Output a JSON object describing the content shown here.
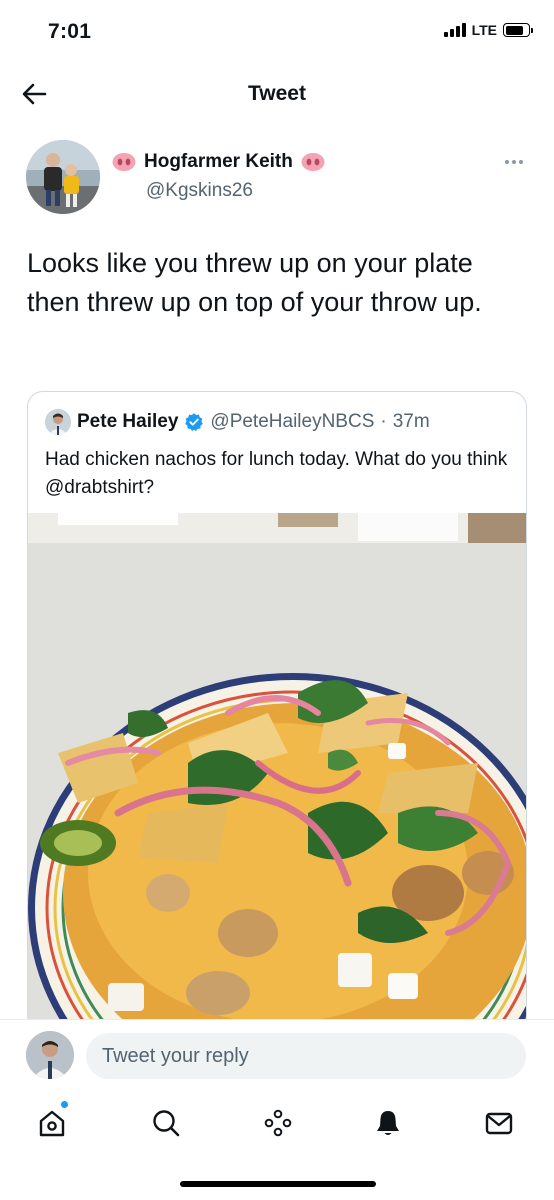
{
  "status_bar": {
    "time": "7:01",
    "network": "LTE",
    "battery_level": 0.8
  },
  "header": {
    "title": "Tweet",
    "back_icon": "arrow-left-icon"
  },
  "tweet": {
    "author_name": "Hogfarmer Keith",
    "author_handle": "@Kgskins26",
    "name_emoji": "pig-nose-emoji",
    "text": "Looks like you threw up on your plate then threw up on top of your throw up."
  },
  "quoted_tweet": {
    "author_name": "Pete Hailey",
    "author_handle": "@PeteHaileyNBCS",
    "separator": "·",
    "time_ago": "37m",
    "text": "Had chicken nachos for lunch today. What do you think @drabtshirt?",
    "image_subject": "chicken nachos on a striped plate"
  },
  "reply": {
    "placeholder": "Tweet your reply"
  },
  "tab_bar": {
    "items": [
      {
        "name": "home",
        "icon": "home-icon",
        "active": true,
        "has_notification_dot": true
      },
      {
        "name": "search",
        "icon": "search-icon",
        "active": false
      },
      {
        "name": "spaces",
        "icon": "spaces-icon",
        "active": false
      },
      {
        "name": "notifications",
        "icon": "bell-icon",
        "active": false
      },
      {
        "name": "messages",
        "icon": "envelope-icon",
        "active": false
      }
    ]
  },
  "colors": {
    "accent": "#1d9bf0",
    "text_primary": "#0f1419",
    "text_secondary": "#536471",
    "border": "#cfd9de"
  }
}
